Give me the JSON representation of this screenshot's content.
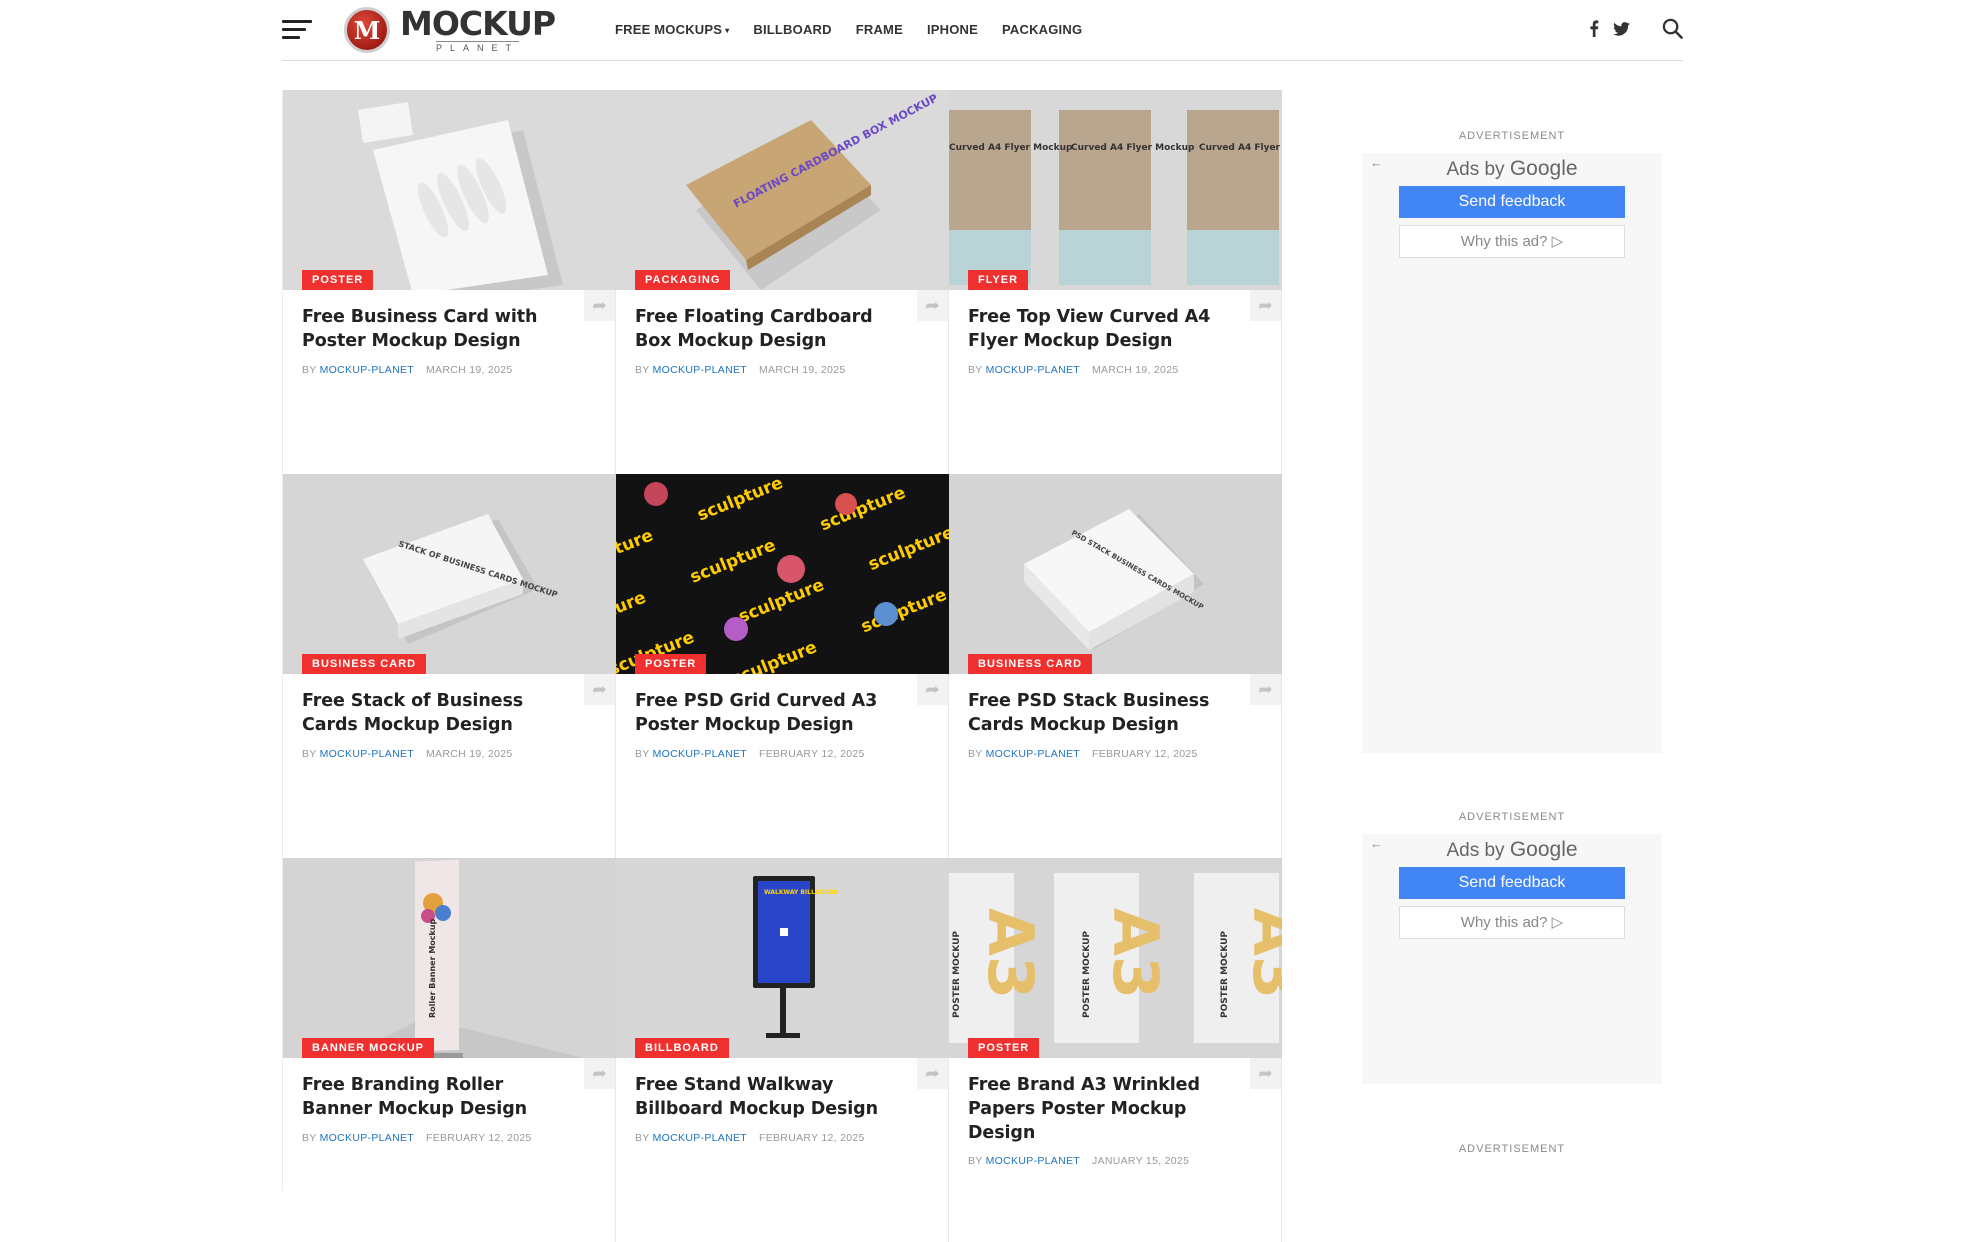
{
  "header": {
    "logo_mark": "M",
    "logo_word": "MOCKUP",
    "logo_sub": "PLANET",
    "nav": [
      "FREE MOCKUPS",
      "BILLBOARD",
      "FRAME",
      "IPHONE",
      "PACKAGING"
    ],
    "nav_caret": "▾"
  },
  "share_glyph": "➦",
  "by_label": "BY",
  "cards": [
    {
      "category": "POSTER",
      "title": "Free Business Card with Poster Mockup Design",
      "author": "MOCKUP-PLANET",
      "date": "MARCH 19, 2025"
    },
    {
      "category": "PACKAGING",
      "title": "Free Floating Cardboard Box Mockup Design",
      "author": "MOCKUP-PLANET",
      "date": "MARCH 19, 2025"
    },
    {
      "category": "FLYER",
      "title": "Free Top View Curved A4 Flyer Mockup Design",
      "author": "MOCKUP-PLANET",
      "date": "MARCH 19, 2025"
    },
    {
      "category": "BUSINESS CARD",
      "title": "Free Stack of Business Cards Mockup Design",
      "author": "MOCKUP-PLANET",
      "date": "MARCH 19, 2025"
    },
    {
      "category": "POSTER",
      "title": "Free PSD Grid Curved A3 Poster Mockup Design",
      "author": "MOCKUP-PLANET",
      "date": "FEBRUARY 12, 2025"
    },
    {
      "category": "BUSINESS CARD",
      "title": "Free PSD Stack Business Cards Mockup Design",
      "author": "MOCKUP-PLANET",
      "date": "FEBRUARY 12, 2025"
    },
    {
      "category": "BANNER MOCKUP",
      "title": "Free Branding Roller Banner Mockup Design",
      "author": "MOCKUP-PLANET",
      "date": "FEBRUARY 12, 2025"
    },
    {
      "category": "BILLBOARD",
      "title": "Free Stand Walkway Billboard Mockup Design",
      "author": "MOCKUP-PLANET",
      "date": "FEBRUARY 12, 2025"
    },
    {
      "category": "POSTER",
      "title": "Free Brand A3 Wrinkled Papers Poster Mockup Design",
      "author": "MOCKUP-PLANET",
      "date": "JANUARY 15, 2025"
    }
  ],
  "thumb_text": {
    "flyer_label": "Curved A4 Flyer Mockup",
    "box_label": "FLOATING CARDBOARD BOX MOCKUP",
    "cards_stack_label": "STACK OF BUSINESS CARDS MOCKUP",
    "psd_stack_label": "PSD STACK BUSINESS CARDS MOCKUP",
    "sculpture_word": "sculpture",
    "billboard_label": "WALKWAY BILLBOARD",
    "roller_label": "Roller Banner Mockup",
    "a3_label": "A3",
    "poster_mockup_label": "POSTER MOCKUP"
  },
  "ads": [
    {
      "label": "ADVERTISEMENT",
      "back": "←",
      "ads_by": "Ads by",
      "google": "Google",
      "send_feedback": "Send feedback",
      "why": "Why this ad? ▷"
    },
    {
      "label": "ADVERTISEMENT",
      "back": "←",
      "ads_by": "Ads by",
      "google": "Google",
      "send_feedback": "Send feedback",
      "why": "Why this ad? ▷"
    },
    {
      "label": "ADVERTISEMENT"
    }
  ],
  "colors": {
    "accent": "#f0302f",
    "link": "#1e73be",
    "google_blue": "#4285f4"
  }
}
